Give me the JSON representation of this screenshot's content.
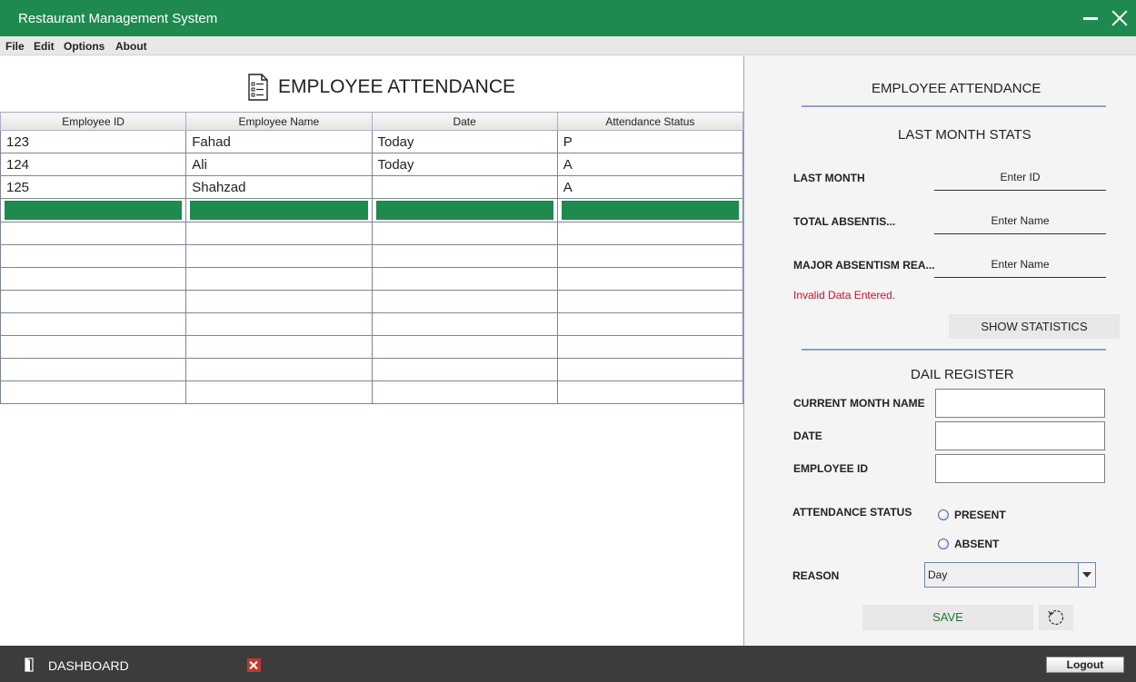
{
  "window": {
    "title": "Restaurant Management System"
  },
  "menu": [
    "File",
    "Edit",
    "Options",
    "About"
  ],
  "main": {
    "heading": "EMPLOYEE ATTENDANCE",
    "table": {
      "columns": [
        "Employee ID",
        "Employee Name",
        "Date",
        "Attendance Status"
      ],
      "rows": [
        [
          "123",
          "Fahad",
          "Today",
          "P"
        ],
        [
          "124",
          "Ali",
          "Today",
          "A"
        ],
        [
          "125",
          "Shahzad",
          "",
          "A"
        ]
      ],
      "selected_row_index": 3,
      "empty_rows": 8
    }
  },
  "panel": {
    "title": "EMPLOYEE ATTENDANCE",
    "stats": {
      "title": "LAST MONTH STATS",
      "fields": [
        {
          "label": "LAST MONTH",
          "placeholder": "Enter ID"
        },
        {
          "label": "TOTAL ABSENTIS...",
          "placeholder": "Enter Name"
        },
        {
          "label": "MAJOR ABSENTISM REA...",
          "placeholder": "Enter Name"
        }
      ],
      "error": "Invalid Data Entered.",
      "button": "SHOW STATISTICS"
    },
    "register": {
      "title": "DAIL REGISTER",
      "fields": [
        {
          "label": "CURRENT MONTH NAME",
          "value": ""
        },
        {
          "label": "DATE",
          "value": ""
        },
        {
          "label": "EMPLOYEE ID",
          "value": ""
        }
      ],
      "status_label": "ATTENDANCE STATUS",
      "status_options": [
        "PRESENT",
        "ABSENT"
      ],
      "reason_label": "REASON",
      "reason_value": "Day",
      "save": "SAVE"
    }
  },
  "footer": {
    "dashboard": "DASHBOARD",
    "logout": "Logout"
  },
  "colors": {
    "brand": "#1f8a4f",
    "footer": "#3c3c3c",
    "error": "#c8102e"
  }
}
